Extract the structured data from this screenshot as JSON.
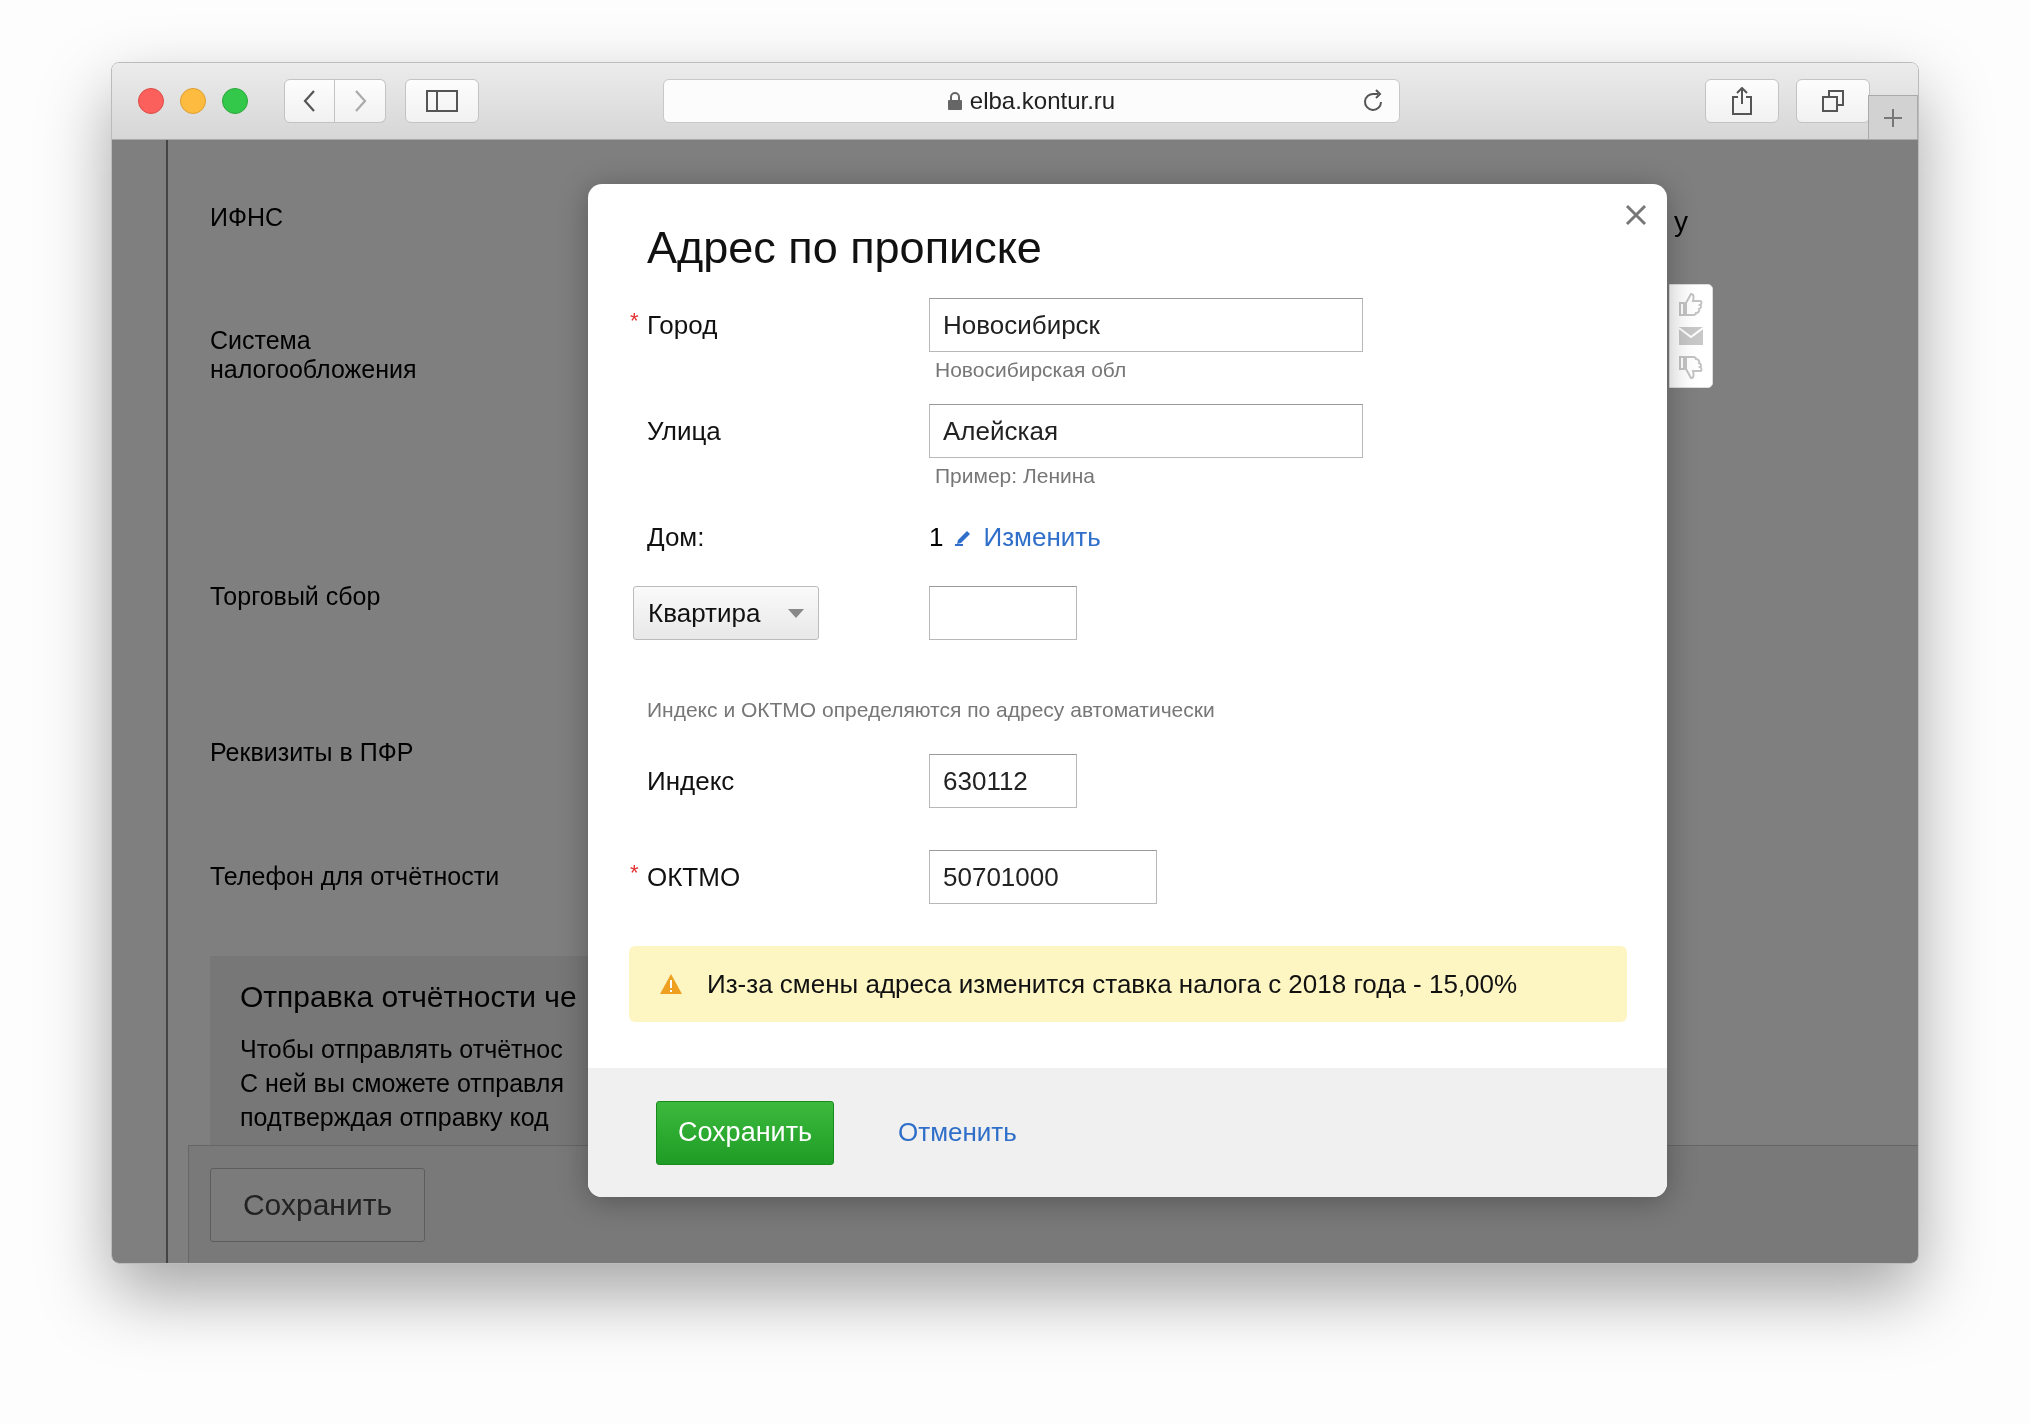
{
  "browser": {
    "url": "elba.kontur.ru"
  },
  "background_page": {
    "fields": [
      {
        "label": "ИФНС"
      },
      {
        "label": "Система\nналогообложения"
      },
      {
        "label": "Торговый сбор"
      },
      {
        "label": "Реквизиты в ПФР"
      },
      {
        "label": "Телефон для отчётности"
      }
    ],
    "fragment": "у",
    "notice": {
      "title": "Отправка отчётности че",
      "lines": [
        "Чтобы отправлять отчётнос",
        "С ней вы сможете отправля",
        "подтверждая отправку код"
      ]
    },
    "save_button": "Сохранить"
  },
  "dialog": {
    "title": "Адрес по прописке",
    "required_mark": "*",
    "rows": [
      {
        "kind": "input",
        "label": "Город",
        "required": true,
        "value": "Новосибирск",
        "hint": "Новосибирская обл"
      },
      {
        "kind": "input",
        "label": "Улица",
        "required": false,
        "value": "Алейская",
        "hint": "Пример: Ленина"
      },
      {
        "kind": "static",
        "label": "Дом:",
        "value": "1",
        "link": "Изменить"
      },
      {
        "kind": "select",
        "label": "Квартира"
      },
      {
        "kind": "note",
        "text": "Индекс и ОКТМО определяются по адресу автоматически"
      },
      {
        "kind": "input",
        "label": "Индекс",
        "required": false,
        "value": "630112"
      },
      {
        "kind": "input",
        "label": "ОКТМО",
        "required": true,
        "value": "50701000"
      }
    ],
    "warning": "Из-за смены адреса изменится ставка налога с 2018 года - 15,00%",
    "save_button": "Сохранить",
    "cancel_link": "Отменить"
  }
}
